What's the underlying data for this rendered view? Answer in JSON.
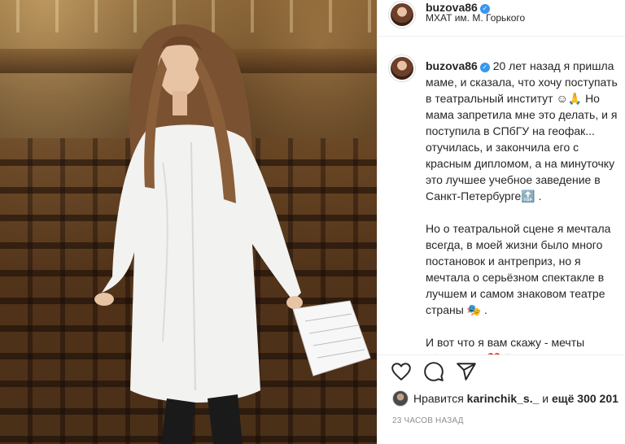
{
  "post": {
    "username": "buzova86",
    "verified_glyph": "✓",
    "location": "МХАТ им. М. Горького"
  },
  "caption": {
    "username": "buzova86",
    "paragraph1": "20 лет назад я пришла маме, и сказала, что хочу поступать в театральный институт ☺🙏 Но мама запретила мне это делать, и я поступила в СПбГУ на геофак... отучилась, и закончила его с красным дипломом, а на минуточку это лучшее учебное заведение в Санкт-Петербурге🔝 .",
    "paragraph2": "Но о театральной сцене я мечтала всегда, в моей жизни было много постановок и антреприз, но я мечтала о серьёзном спектакле в лучшем и самом знаковом театре страны 🎭 .",
    "paragraph3": "И вот что я вам скажу - мечты сбываются ❤️🙌 Просто нужно"
  },
  "actions": {
    "like_icon": "heart-icon",
    "comment_icon": "comment-icon",
    "share_icon": "share-icon"
  },
  "likes": {
    "prefix": "Нравится",
    "liker": "karinchik_s._",
    "middle": "и",
    "others": "ещё 300 201"
  },
  "timestamp": "23 часов назад",
  "colors": {
    "verified": "#3897f0",
    "text": "#262626",
    "muted": "#8e8e8e",
    "divider": "#efefef"
  }
}
